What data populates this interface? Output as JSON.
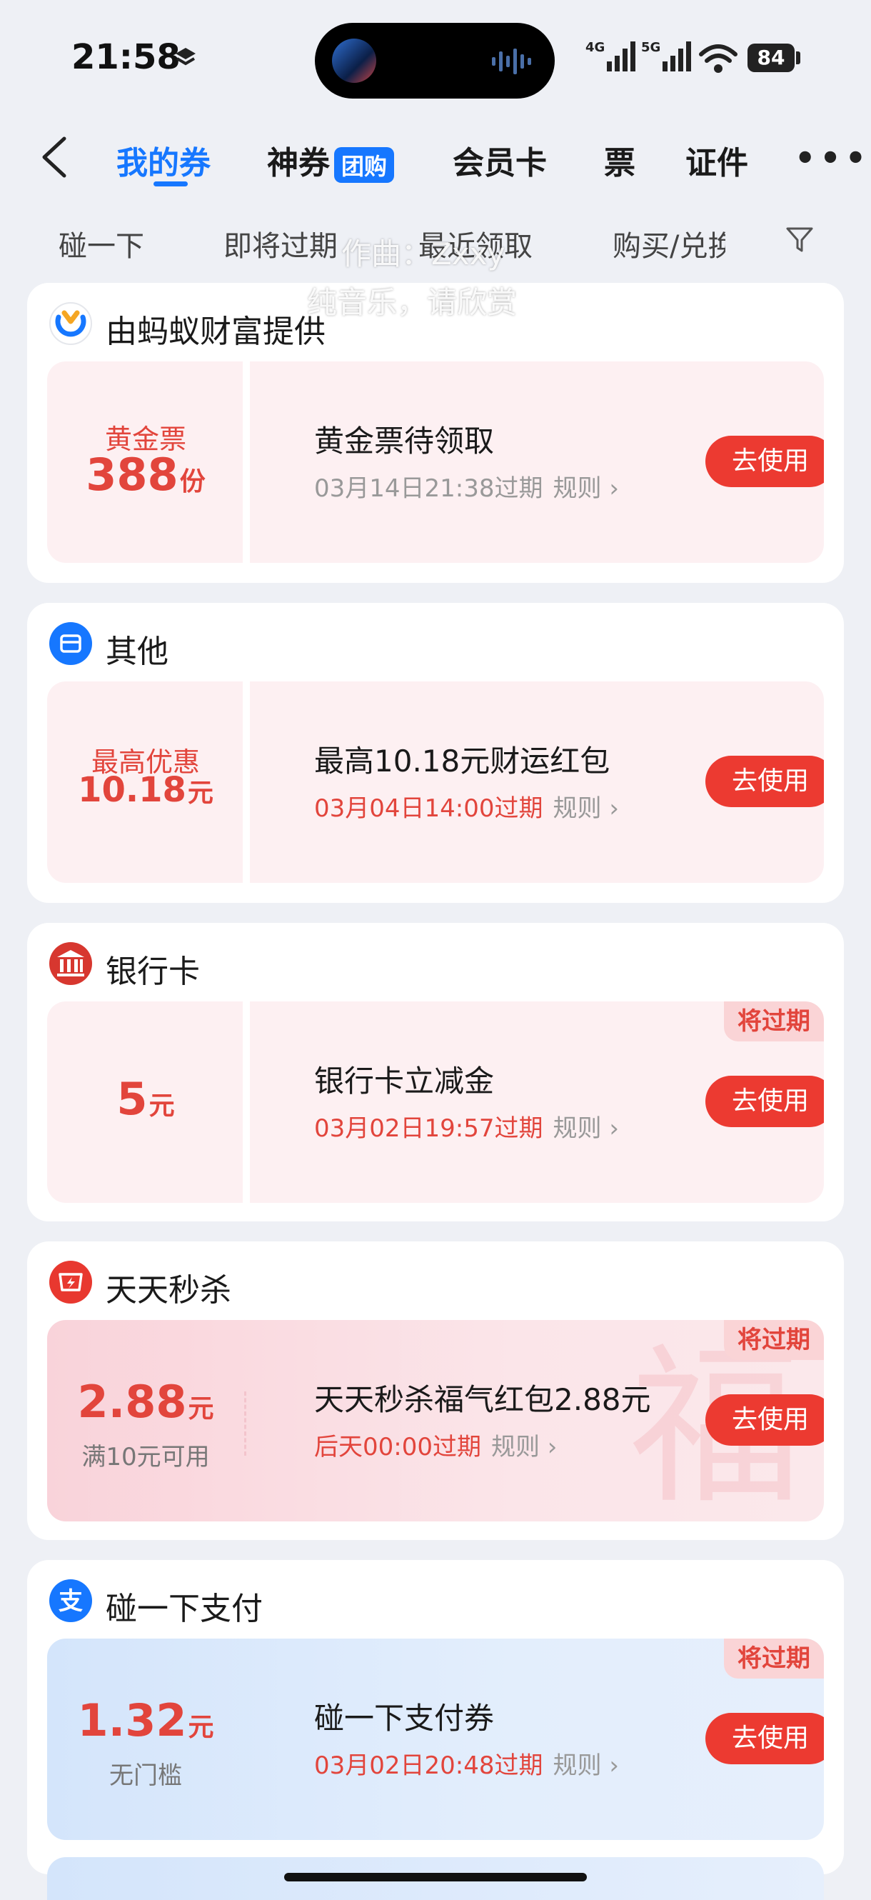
{
  "status_bar": {
    "time": "21:58",
    "net1": "4G",
    "net2": "5G",
    "battery": "84"
  },
  "nav": {
    "tabs": [
      "我的券",
      "神券",
      "会员卡",
      "票",
      "证件"
    ],
    "badge": "团购",
    "more": "•••"
  },
  "filters": [
    "碰一下",
    "即将过期",
    "最近领取",
    "购买/兑换"
  ],
  "overlay": {
    "line1": "作曲：Zxxy",
    "line2": "纯音乐，请欣赏"
  },
  "cards": [
    {
      "brand": "由蚂蚁财富提供",
      "icon": "ant-fortune-icon",
      "label": "黄金票",
      "amount": "388",
      "unit": "份",
      "title": "黄金票待领取",
      "expiry": "03月14日21:38过期",
      "rule": "规则",
      "button": "去使用"
    },
    {
      "brand": "其他",
      "icon": "shop-icon",
      "label": "最高优惠",
      "amount": "10.18",
      "unit": "元",
      "title": "最高10.18元财运红包",
      "expiry": "03月04日14:00过期",
      "rule": "规则",
      "button": "去使用"
    },
    {
      "brand": "银行卡",
      "icon": "bank-icon",
      "amount": "5",
      "unit": "元",
      "title": "银行卡立减金",
      "expiry": "03月02日19:57过期",
      "rule": "规则",
      "button": "去使用",
      "tag": "将过期"
    },
    {
      "brand": "天天秒杀",
      "icon": "flash-sale-icon",
      "amount": "2.88",
      "unit": "元",
      "sub": "满10元可用",
      "title": "天天秒杀福气红包2.88元",
      "expiry": "后天00:00过期",
      "rule": "规则",
      "button": "去使用",
      "tag": "将过期",
      "bg_char": "福"
    },
    {
      "brand": "碰一下支付",
      "icon": "alipay-icon",
      "amount": "1.32",
      "unit": "元",
      "sub": "无门槛",
      "title": "碰一下支付券",
      "expiry": "03月02日20:48过期",
      "rule": "规则",
      "button": "去使用",
      "tag": "将过期"
    }
  ],
  "colors": {
    "accent_blue": "#1677ff",
    "accent_red": "#ec3a31",
    "page_bg": "#eef0f5"
  }
}
